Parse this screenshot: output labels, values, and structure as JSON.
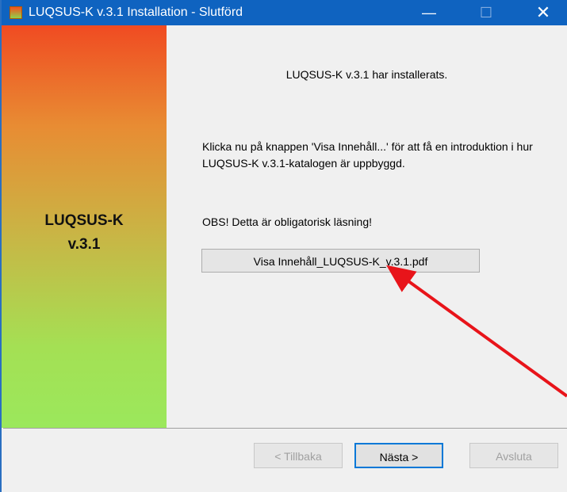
{
  "window": {
    "title": "LUQSUS-K v.3.1 Installation - Slutförd",
    "minimize_glyph": "—",
    "maximize_glyph": "☐",
    "close_glyph": "✕"
  },
  "sidebar": {
    "title_line1": "LUQSUS-K",
    "title_line2": "v.3.1"
  },
  "content": {
    "headline": "LUQSUS-K v.3.1 har installerats.",
    "instruction": "Klicka nu på knappen 'Visa Innehåll...' för att få en introduktion i hur LUQSUS-K v.3.1-katalogen är uppbyggd.",
    "notice": "OBS! Detta är obligatorisk läsning!",
    "pdf_button_label": "Visa Innehåll_LUQSUS-K_v.3.1.pdf"
  },
  "footer": {
    "back_label": "< Tillbaka",
    "next_label": "Nästa >",
    "cancel_label": "Avsluta"
  },
  "colors": {
    "titlebar": "#0f63c0",
    "sidebar_top": "#f04b22",
    "sidebar_bottom": "#9be85c",
    "annotation_arrow": "#e8141a"
  }
}
